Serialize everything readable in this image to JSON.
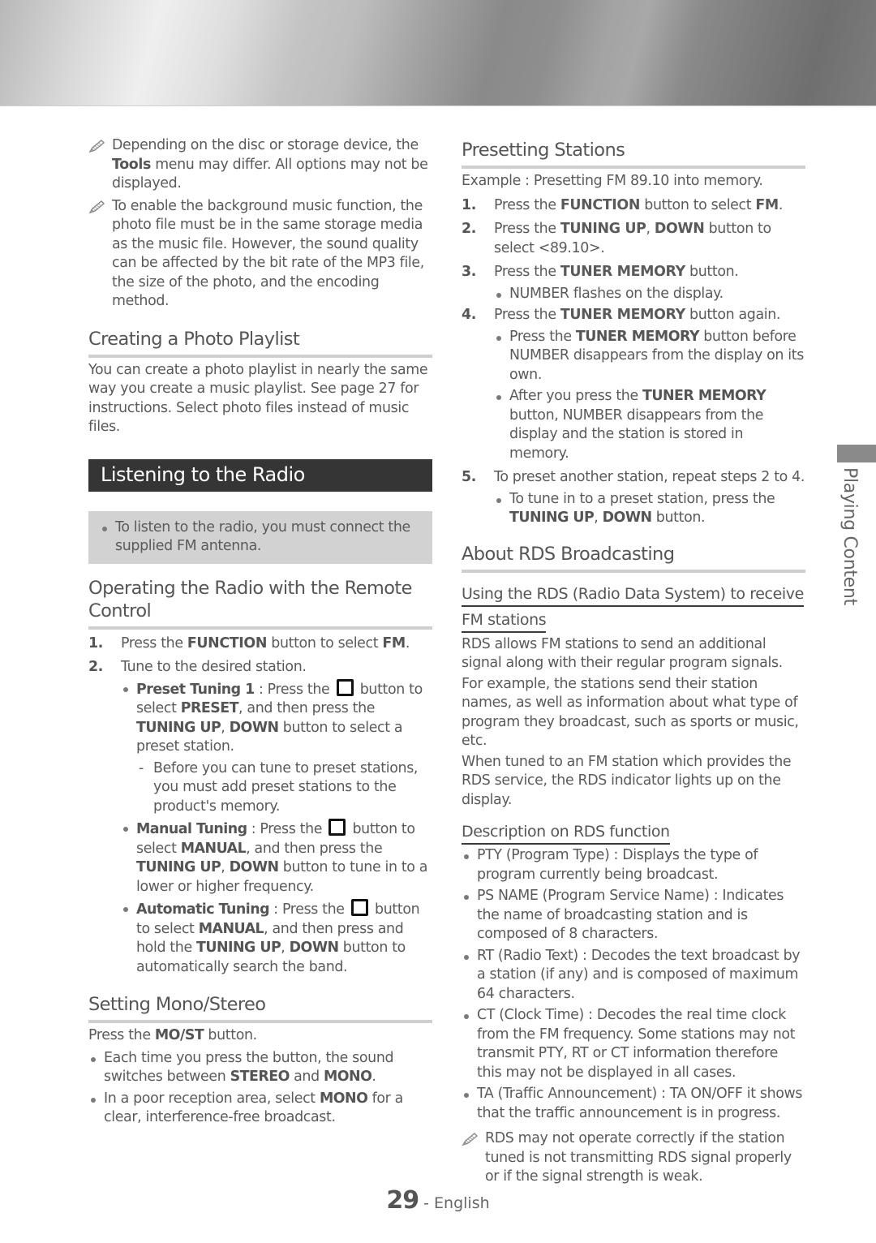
{
  "left": {
    "notes": [
      {
        "pre": "Depending on the disc or storage device, the ",
        "bold": "Tools",
        "post": " menu may differ. All options may not be displayed."
      },
      {
        "text": "To enable the background music function, the photo file must be in the same storage media as the music file. However, the sound quality can be affected by the bit rate of the MP3 file, the size of the photo, and the encoding method."
      }
    ],
    "photo_playlist": {
      "title": "Creating a Photo Playlist",
      "body": "You can create a photo playlist in nearly the same way you create a music playlist. See page 27 for instructions. Select photo files instead of music files."
    },
    "radio": {
      "title": "Listening to the Radio",
      "box_note": "To listen to the radio, you must connect the supplied FM antenna."
    },
    "operating": {
      "title": "Operating the Radio with the Remote Control",
      "step1": {
        "num": "1.",
        "pre": "Press the ",
        "b1": "FUNCTION",
        "mid": " button to select ",
        "b2": "FM",
        "post": "."
      },
      "step2": {
        "num": "2.",
        "text": "Tune to the desired station."
      },
      "preset": {
        "label": "Preset Tuning 1",
        "a": " : Press the ",
        "b": " button to select ",
        "c": "PRESET",
        "d": ", and then press the ",
        "e": "TUNING UP",
        "f": ", ",
        "g": "DOWN",
        "h": " button to select a preset station."
      },
      "preset_dash": {
        "mark": "-",
        "text": "Before you can tune to preset stations, you must add preset stations to the product's memory."
      },
      "manual": {
        "label": "Manual Tuning",
        "a": " : Press the ",
        "b": " button to select ",
        "c": "MANUAL",
        "d": ", and then press the ",
        "e": "TUNING UP",
        "f": ", ",
        "g": "DOWN",
        "h": " button to tune in to a lower or higher frequency."
      },
      "auto": {
        "label": "Automatic Tuning",
        "a": " : Press the ",
        "b": " button to select ",
        "c": "MANUAL",
        "d": ", and then press and hold the ",
        "e": "TUNING UP",
        "f": ", ",
        "g": "DOWN",
        "h": " button to automatically search the band."
      }
    },
    "mono": {
      "title": "Setting Mono/Stereo",
      "intro": {
        "pre": "Press the ",
        "bold": "MO/ST",
        "post": " button."
      },
      "b1": {
        "pre": "Each time you press the button, the sound switches between ",
        "b1": "STEREO",
        "mid": " and ",
        "b2": "MONO",
        "post": "."
      },
      "b2": {
        "pre": "In a poor reception area, select ",
        "bold": "MONO",
        "post": " for a clear, interference-free broadcast."
      }
    }
  },
  "right": {
    "presetting": {
      "title": "Presetting Stations",
      "example": "Example : Presetting FM 89.10 into memory.",
      "s1": {
        "num": "1.",
        "pre": "Press the ",
        "b1": "FUNCTION",
        "mid": " button to select ",
        "b2": "FM",
        "post": "."
      },
      "s2": {
        "num": "2.",
        "pre": "Press the ",
        "b1": "TUNING UP",
        "mid": ", ",
        "b2": "DOWN",
        "post": " button to select <89.10>."
      },
      "s3": {
        "num": "3.",
        "pre": "Press the ",
        "bold": "TUNER MEMORY",
        "post": " button."
      },
      "s3_bullet": "NUMBER flashes on the display.",
      "s4": {
        "num": "4.",
        "pre": "Press the ",
        "bold": "TUNER MEMORY",
        "post": " button again."
      },
      "s4_b1": {
        "pre": "Press the ",
        "bold": "TUNER MEMORY",
        "post": " button before NUMBER disappears from the display on its own."
      },
      "s4_b2": {
        "pre": "After you press the ",
        "bold": "TUNER MEMORY",
        "post": " button, NUMBER disappears from the display and the station is stored in memory."
      },
      "s5": {
        "num": "5.",
        "text": "To preset another station, repeat steps 2 to 4."
      },
      "s5_b": {
        "pre": "To tune in to a preset station, press the ",
        "b1": "TUNING UP",
        "mid": ", ",
        "b2": "DOWN",
        "post": " button."
      }
    },
    "rds": {
      "title": "About RDS Broadcasting",
      "sub1_line1": "Using the RDS (Radio Data System) to receive",
      "sub1_line2": "FM stations",
      "p1": "RDS allows FM stations to send an additional signal along with their regular program signals.",
      "p2": "For example, the stations send their station names, as well as information about what type of program they broadcast, such as sports or music, etc.",
      "p3": "When tuned to an FM station which provides the RDS service, the RDS indicator lights up on the display.",
      "sub2": "Description on RDS function",
      "items": [
        "PTY (Program Type) : Displays the type of program currently being broadcast.",
        "PS NAME (Program Service Name) : Indicates the name of broadcasting station and is composed of 8 characters.",
        "RT (Radio Text) : Decodes the text broadcast by a station (if any) and is composed of maximum 64 characters.",
        "CT (Clock Time) : Decodes the real time clock from the FM frequency. Some stations may not transmit PTY, RT or CT information therefore this may not be displayed in all cases.",
        "TA (Traffic Announcement) : TA ON/OFF it shows that the traffic announcement is in progress."
      ],
      "note": "RDS may not operate correctly if the station tuned is not transmitting RDS signal properly or if the signal strength is weak."
    }
  },
  "side_tab": {
    "label": "Playing Content"
  },
  "footer": {
    "page": "29",
    "sep": " - ",
    "lang": "English"
  }
}
